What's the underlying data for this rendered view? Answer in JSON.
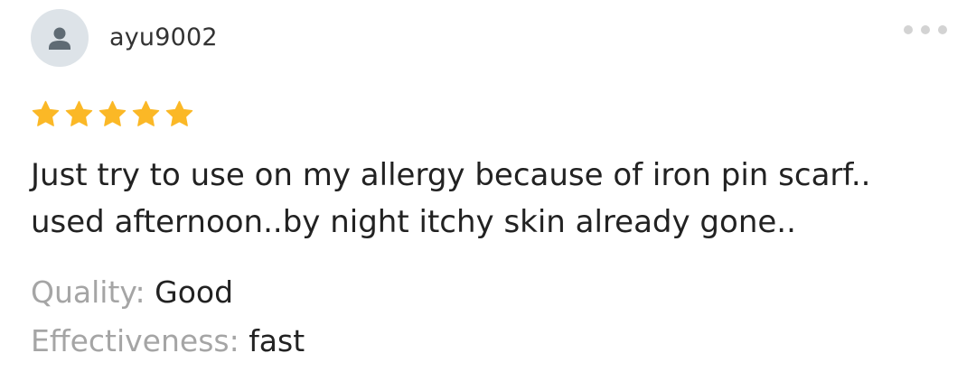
{
  "review": {
    "username": "ayu9002",
    "rating": 5,
    "rating_max": 5,
    "star_color": "#fbb826",
    "text_lines": [
      "Just try to use on my allergy because of iron pin scarf..",
      "used afternoon..by night itchy skin already gone.."
    ],
    "attributes": [
      {
        "label": "Quality:",
        "value": "Good"
      },
      {
        "label": "Effectiveness:",
        "value": "fast"
      }
    ]
  },
  "icons": {
    "avatar": "user-silhouette-icon",
    "menu": "more-dots-icon",
    "star": "star-icon"
  }
}
